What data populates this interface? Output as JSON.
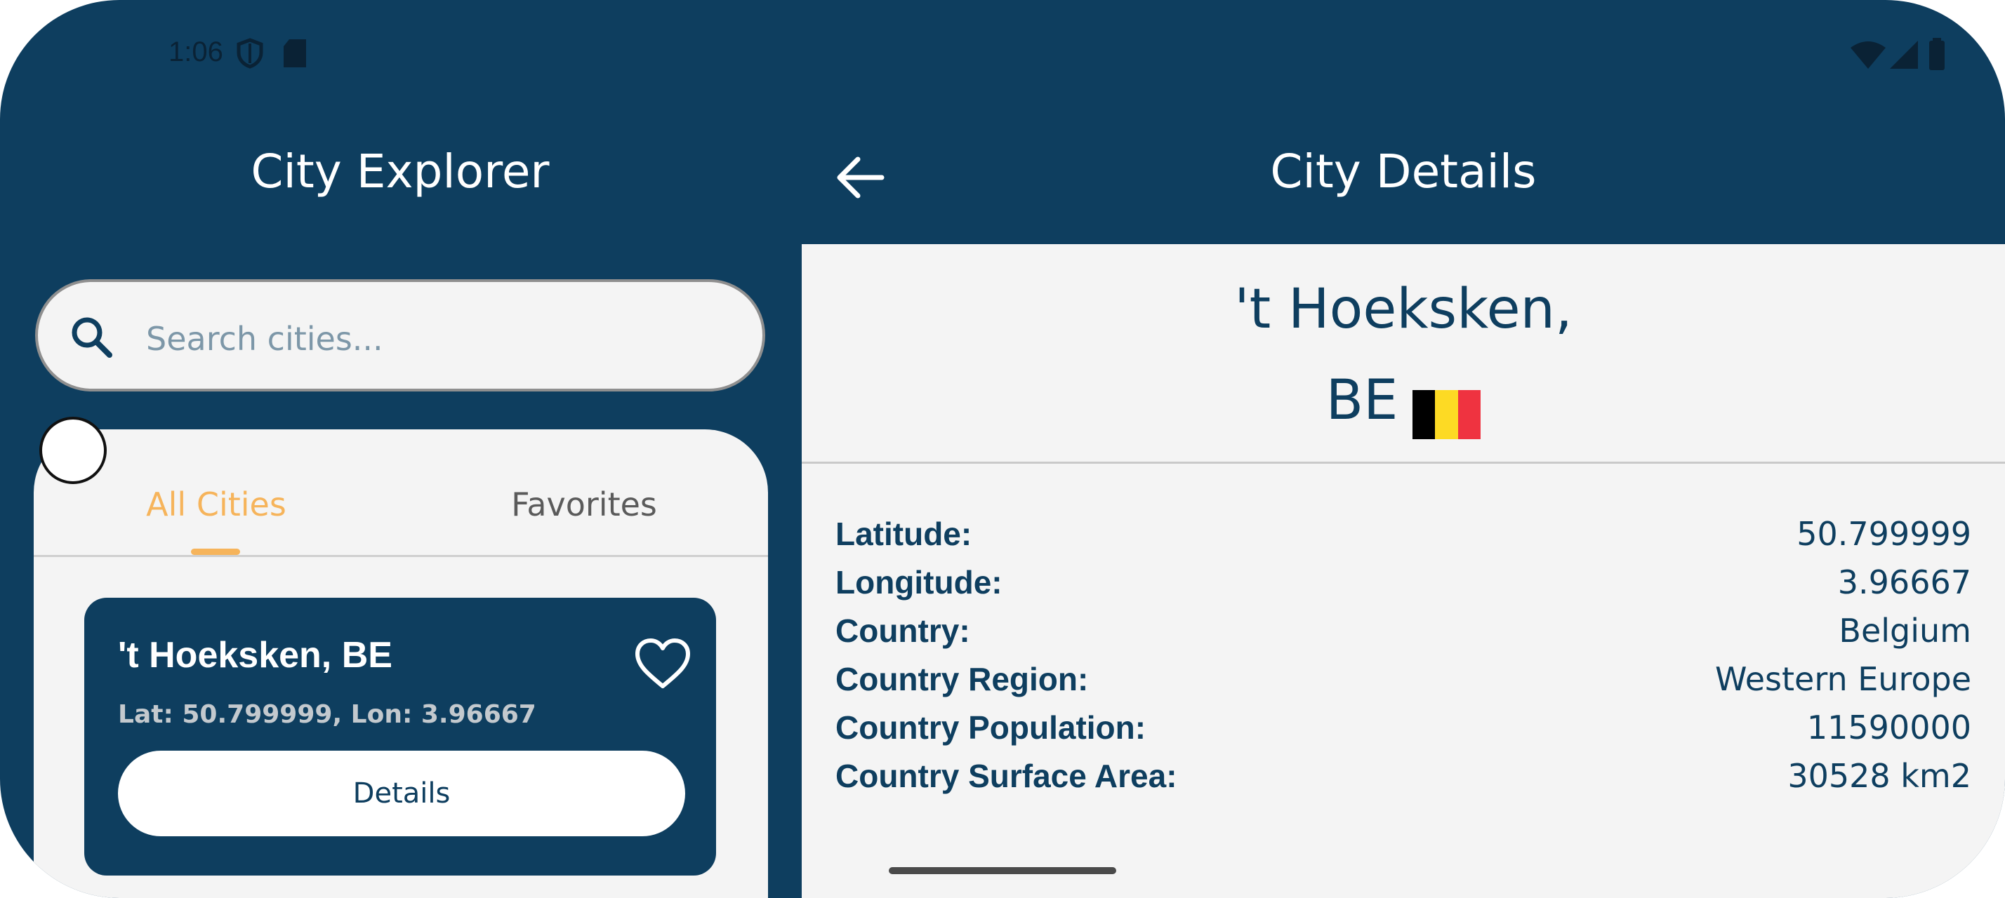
{
  "status_bar": {
    "time": "1:06",
    "icons": [
      "shield-icon",
      "sd-card-icon",
      "wifi-icon",
      "cell-signal-icon",
      "battery-icon"
    ]
  },
  "left_pane": {
    "title": "City Explorer",
    "search": {
      "placeholder": "Search cities...",
      "value": ""
    },
    "tabs": [
      {
        "label": "All Cities",
        "selected": true
      },
      {
        "label": "Favorites",
        "selected": false
      }
    ],
    "city_card": {
      "title": "'t Hoeksken, BE",
      "subtitle": "Lat: 50.799999, Lon: 3.96667",
      "button_label": "Details",
      "favorite_icon": "heart-outline-icon"
    }
  },
  "right_pane": {
    "title": "City Details",
    "city_name_line1": "'t Hoeksken,",
    "city_name_line2": "BE",
    "flag": {
      "country": "Belgium",
      "colors": [
        "#000000",
        "#FDDA24",
        "#EF3340"
      ]
    },
    "info": [
      {
        "label": "Latitude:",
        "value": "50.799999"
      },
      {
        "label": "Longitude:",
        "value": "3.96667"
      },
      {
        "label": "Country:",
        "value": "Belgium"
      },
      {
        "label": "Country Region:",
        "value": "Western Europe"
      },
      {
        "label": "Country Population:",
        "value": "11590000"
      },
      {
        "label": "Country Surface Area:",
        "value": "30528 km2"
      }
    ]
  },
  "colors": {
    "primary": "#0E3E5F",
    "accent": "#F6B45B",
    "surface": "#F4F4F4"
  }
}
